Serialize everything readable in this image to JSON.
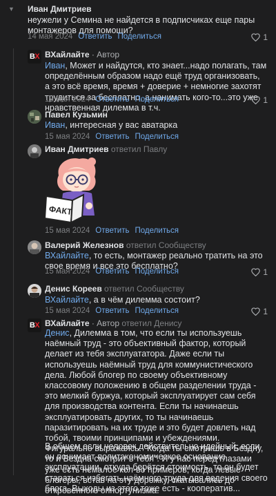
{
  "comments": [
    {
      "author": "Иван Дмитриев",
      "text": "неужели у Семина не найдется в подписчиках еще пары монтажеров для помощи?",
      "date": "14 мая 2024",
      "reply_label": "Ответить",
      "share_label": "Поделиться",
      "likes": "1"
    },
    {
      "author": "ВХайлайте",
      "author_tag": " · Автор",
      "mention": "Иван",
      "text": ", Может и найдутся, кто знает...надо полагать, там определённым образом надо ещё труд организовать, а это всё время, время + доверие + немногие захотят трудиться за бесплатно, а нанимать кого-то...это уже нравственная дилемма в т.ч.",
      "date": "15 мая 2024",
      "reply_label": "Ответить",
      "share_label": "Поделиться",
      "likes": "1"
    },
    {
      "author": "Павел Кузьмин",
      "mention": "Иван",
      "text": ", интересная у вас аватарка",
      "date": "15 мая 2024",
      "reply_label": "Ответить",
      "share_label": "Поделиться"
    },
    {
      "author": "Иван Дмитриев",
      "reply_to": " ответил Павлу",
      "sticker_text": "ФАКТ",
      "date": "15 мая 2024",
      "reply_label": "Ответить",
      "share_label": "Поделиться"
    },
    {
      "author": "Валерий Железнов",
      "reply_to": " ответил Сообществу",
      "mention": "ВХайлайте",
      "text": ", то есть, монтажер реально тратить на это свое время и все это бесплатно?",
      "date": "15 мая 2024",
      "reply_label": "Ответить",
      "share_label": "Поделиться",
      "likes": "1"
    },
    {
      "author": "Денис Кореев",
      "reply_to": " ответил Сообществу",
      "mention": "ВХайлайте",
      "text": ", а в чём дилемма состоит?",
      "date": "15 мая 2024",
      "reply_label": "Ответить",
      "share_label": "Поделиться",
      "likes": "1"
    },
    {
      "author": "ВХайлайте",
      "author_tag": " · Автор",
      "reply_to": " ответил Денису",
      "mention": "Денис",
      "text": ", Дилемма в том, что если ты используешь наёмный труд - это объективный фактор, который делает из тебя эксплуататора. Даже если ты используешь наёмный труд для коммунистического дела. Любой блогер по своему объективному классовому положению в общем разделении труда - это мелкий буржуа, который эксплуатирует сам себя для производства контента. Если ты начинаешь эксплуатировать других, то ты начинаешь паразитировать на их труде и это будет довлеть над тобой, твоими принципами и убеждениями. Фигурально выражаясь: \"Когда ты смотришь в Бездну, то и Бездна смотрит в тебя\". И у нас перед глазами уже есть немалое кол-во примеров, когда левые блогеры, встав на эту дорожку, скатывались до откровенного оппортунизма.",
      "text2": "В общем если человек действительно идейный, если он понимает политэкономическое основание эксплуатации, откуда берётся стоимость, то он будет стараться избегать наёмного труда для ведения своего блога. Выходы из этого тоже есть - кооператив..."
    }
  ],
  "logo": {
    "b": "В",
    "x": "Х"
  }
}
